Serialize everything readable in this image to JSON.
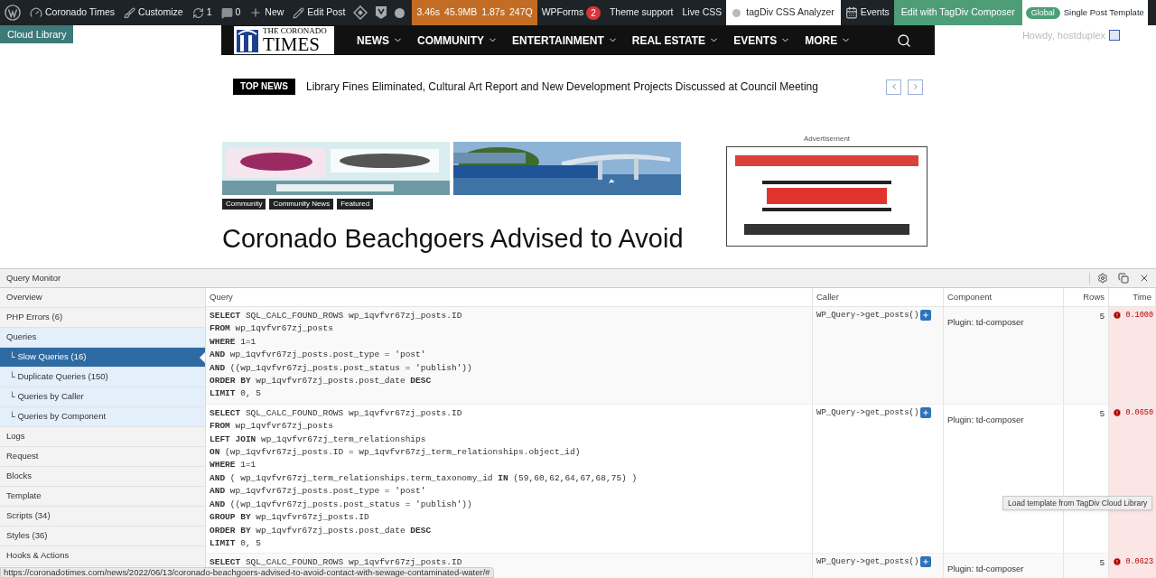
{
  "admin_bar": {
    "site": "Coronado Times",
    "customize": "Customize",
    "updates": "1",
    "comments": "0",
    "new": "New",
    "edit_post": "Edit Post",
    "qm_stats": [
      "3.46s",
      "45.9MB",
      "1.87s",
      "247Q"
    ],
    "wpforms": {
      "label": "WPForms",
      "badge": "2"
    },
    "theme_support": "Theme support",
    "live_css": "Live CSS",
    "css_analyzer": "tagDiv CSS Analyzer",
    "events": "Events",
    "edit_composer": "Edit with TagDiv Composer",
    "template_badge": "Global",
    "template": "Single Post Template",
    "howdy": "Howdy, hostduplex"
  },
  "cloud_library": "Cloud Library",
  "site": {
    "logo_lines": [
      "THE CORONADO",
      "TIMES"
    ],
    "menu": [
      "NEWS",
      "COMMUNITY",
      "ENTERTAINMENT",
      "REAL ESTATE",
      "EVENTS",
      "MORE"
    ],
    "top_news": {
      "label": "TOP NEWS",
      "headline": "Library Fines Eliminated, Cultural Art Report and New Development Projects Discussed at Council Meeting"
    },
    "tags": [
      "Community",
      "Community News",
      "Featured"
    ],
    "article_title": "Coronado Beachgoers Advised to Avoid",
    "ad_label": "Advertisement"
  },
  "query_monitor": {
    "title": "Query Monitor",
    "nav": [
      {
        "label": "Overview",
        "selected": false
      },
      {
        "label": "PHP Errors (6)",
        "selected": false
      },
      {
        "label": "Queries",
        "selected": false,
        "children": [
          {
            "branch": "└",
            "label": "Slow Queries (16)",
            "selected": true
          },
          {
            "branch": "└",
            "label": "Duplicate Queries (150)",
            "selected": false
          },
          {
            "branch": "└",
            "label": "Queries by Caller",
            "selected": false
          },
          {
            "branch": "└",
            "label": "Queries by Component",
            "selected": false
          }
        ]
      },
      {
        "label": "Logs",
        "selected": false
      },
      {
        "label": "Request",
        "selected": false
      },
      {
        "label": "Blocks",
        "selected": false
      },
      {
        "label": "Template",
        "selected": false
      },
      {
        "label": "Scripts (34)",
        "selected": false
      },
      {
        "label": "Styles (36)",
        "selected": false
      },
      {
        "label": "Hooks & Actions",
        "selected": false
      }
    ],
    "columns": [
      "Query",
      "Caller",
      "Component",
      "Rows",
      "Time"
    ],
    "rows": [
      {
        "sql": [
          "**SELECT** SQL_CALC_FOUND_ROWS wp_1qvfvr67zj_posts.ID",
          "**FROM** wp_1qvfvr67zj_posts",
          "**WHERE** 1=1",
          "**AND** wp_1qvfvr67zj_posts.post_type = 'post'",
          "**AND** ((wp_1qvfvr67zj_posts.post_status = 'publish'))",
          "**ORDER BY** wp_1qvfvr67zj_posts.post_date **DESC**",
          "**LIMIT** 0, 5"
        ],
        "caller": "WP_Query->get_posts()",
        "component": "Plugin: td-composer",
        "rows": "5",
        "time": "0.1000",
        "slow": true
      },
      {
        "sql": [
          "**SELECT** SQL_CALC_FOUND_ROWS wp_1qvfvr67zj_posts.ID",
          "**FROM** wp_1qvfvr67zj_posts",
          "**LEFT JOIN** wp_1qvfvr67zj_term_relationships",
          "**ON** (wp_1qvfvr67zj_posts.ID = wp_1qvfvr67zj_term_relationships.object_id)",
          "**WHERE** 1=1",
          "**AND** ( wp_1qvfvr67zj_term_relationships.term_taxonomy_id **IN** (59,60,62,64,67,68,75) )",
          "**AND** wp_1qvfvr67zj_posts.post_type = 'post'",
          "**AND** ((wp_1qvfvr67zj_posts.post_status = 'publish'))",
          "**GROUP BY** wp_1qvfvr67zj_posts.ID",
          "**ORDER BY** wp_1qvfvr67zj_posts.post_date **DESC**",
          "**LIMIT** 0, 5"
        ],
        "caller": "WP_Query->get_posts()",
        "component": "Plugin: td-composer",
        "rows": "5",
        "time": "0.0650",
        "slow": true
      },
      {
        "sql": [
          "**SELECT** SQL_CALC_FOUND_ROWS wp_1qvfvr67zj_posts.ID"
        ],
        "caller": "WP_Query->get_posts()",
        "component": "Plugin: td-composer",
        "rows": "5",
        "time": "0.0623",
        "slow": true
      }
    ]
  },
  "tooltip": "Load template from TagDiv Cloud Library",
  "status_url": "https://coronadotimes.com/news/2022/06/13/coronado-beachgoers-advised-to-avoid-contact-with-sewage-contaminated-water/#"
}
